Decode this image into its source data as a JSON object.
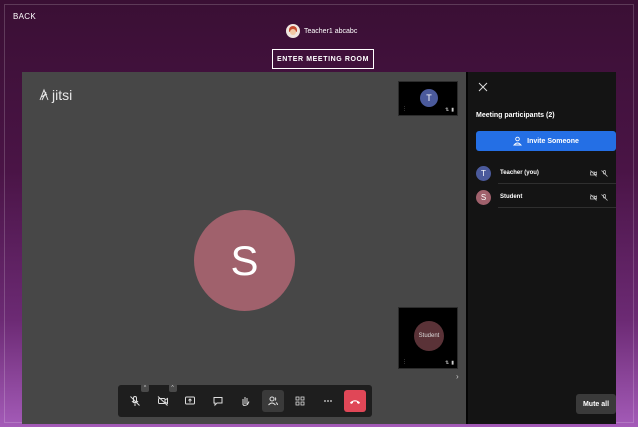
{
  "nav": {
    "back_label": "BACK"
  },
  "user": {
    "name": "Teacher1 abcabc"
  },
  "enter_button": {
    "label": "ENTER MEETING ROOM"
  },
  "stage": {
    "logo_text": "jitsi",
    "dominant_initial": "S",
    "dominant_color": "#a0616c",
    "thumbnails": [
      {
        "initial": "T",
        "color": "#4b5a9c"
      },
      {
        "initial": "",
        "label": "Student",
        "color": "#5a3237"
      }
    ]
  },
  "toolbar": {
    "items": [
      "microphone-muted-icon",
      "camera-off-icon",
      "screen-share-icon",
      "chat-icon",
      "raise-hand-icon",
      "participants-icon",
      "tile-view-icon",
      "more-icon",
      "hangup-icon"
    ],
    "hangup_color": "#e04757"
  },
  "panel": {
    "title": "Meeting participants (2)",
    "invite_label": "Invite Someone",
    "invite_color": "#246fe5",
    "participants": [
      {
        "initial": "T",
        "name": "Teacher (you)",
        "color": "#4b5a9c"
      },
      {
        "initial": "S",
        "name": "Student",
        "color": "#a0616c"
      }
    ],
    "mute_all_label": "Mute all"
  }
}
